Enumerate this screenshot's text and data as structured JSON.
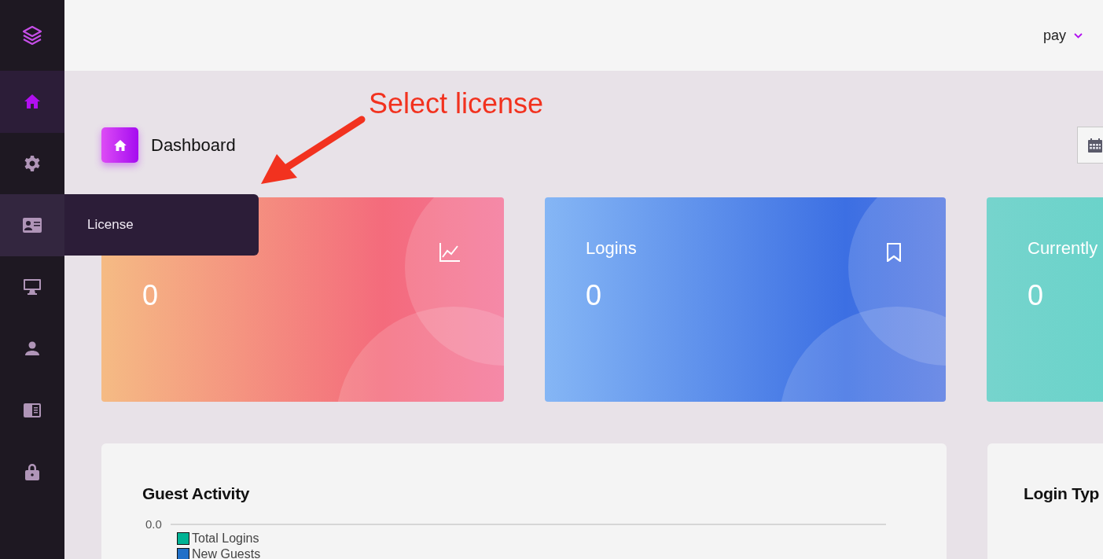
{
  "sidebar": {
    "logo": {
      "kind": "layers"
    },
    "items": [
      {
        "kind": "home",
        "selected": true,
        "hovered": false
      },
      {
        "kind": "gear",
        "selected": false,
        "hovered": false
      },
      {
        "kind": "card",
        "selected": false,
        "hovered": true,
        "tooltip": "License"
      },
      {
        "kind": "monitor",
        "selected": false,
        "hovered": false
      },
      {
        "kind": "user",
        "selected": false,
        "hovered": false
      },
      {
        "kind": "book",
        "selected": false,
        "hovered": false
      },
      {
        "kind": "lock",
        "selected": false,
        "hovered": false
      }
    ]
  },
  "header": {
    "user": "pay"
  },
  "page": {
    "title": "Dashboard"
  },
  "annotation": {
    "text": "Select license"
  },
  "cards": [
    {
      "kind": "orange",
      "value": "0"
    },
    {
      "kind": "blue",
      "title": "Logins",
      "value": "0"
    },
    {
      "kind": "teal",
      "title": "Currently",
      "value": "0"
    }
  ],
  "panels": [
    {
      "title": "Guest Activity",
      "y_tick": "0.0",
      "legend": [
        {
          "name": "Total Logins",
          "color": "#00b394"
        },
        {
          "name": "New Guests",
          "color": "#2070c8"
        }
      ]
    },
    {
      "title": "Login Typ"
    }
  ]
}
